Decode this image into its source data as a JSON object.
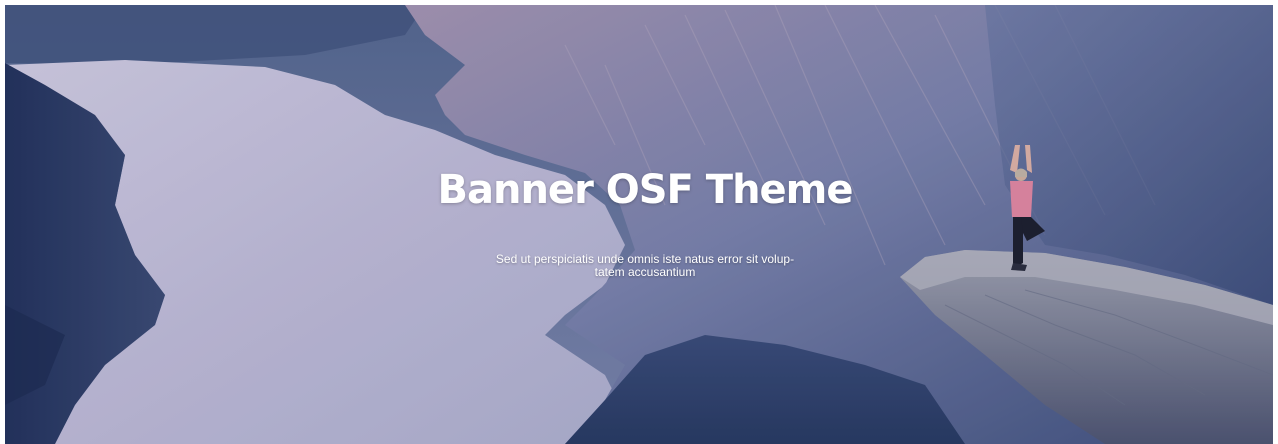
{
  "banner": {
    "title": "Banner OSF Theme",
    "subtitle_line1": "Sed ut perspiciatis unde omnis iste natus error sit volup-",
    "subtitle_line2": "tatem accusantium",
    "text_color": "#ffffff",
    "image_subject": "person doing yoga tree pose on cliff ledge above fjord"
  },
  "colors": {
    "sky": "#5f6f95",
    "water": "#c9c4dc",
    "cliff_left": "#2e3e66",
    "mountain": "#6c7aa6",
    "rock_ledge": "#8e93a3",
    "figure_top": "#e98aa3",
    "figure_pants": "#1b1c2a"
  }
}
